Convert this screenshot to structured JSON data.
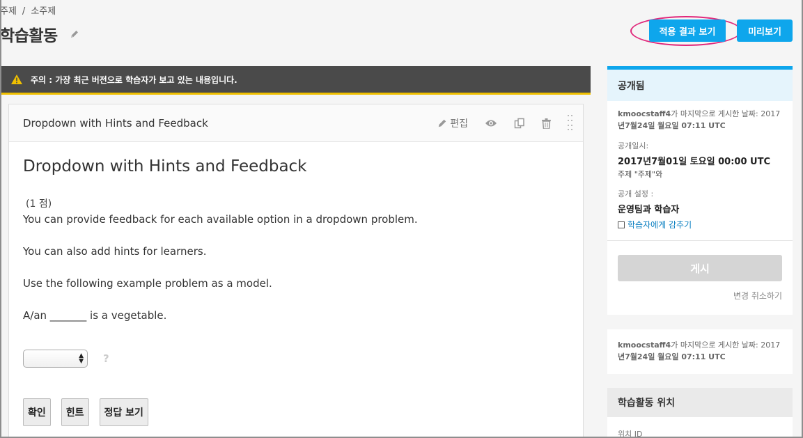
{
  "breadcrumb": {
    "items": [
      "주제",
      "소주제"
    ],
    "separator": "/"
  },
  "page": {
    "title": "학습활동"
  },
  "header": {
    "apply_button": "적용 결과 보기",
    "preview_button": "미리보기"
  },
  "warning": {
    "text": "주의 : 가장 최근 버전으로 학습자가 보고 있는 내용입니다."
  },
  "xblock": {
    "header_title": "Dropdown with Hints and Feedback",
    "edit_label": "편집",
    "problem_title": "Dropdown with Hints and Feedback",
    "points": "(1 점)",
    "paragraphs": [
      "You can provide feedback for each available option in a dropdown problem.",
      "You can also add hints for learners.",
      "Use the following example problem as a model.",
      "A/an _______ is a vegetable."
    ],
    "dropdown_value": "",
    "help_mark": "?",
    "buttons": {
      "check": "확인",
      "hint": "힌트",
      "show_answer": "정답 보기"
    }
  },
  "publish": {
    "status": "공개됨",
    "last_published_user": "kmoocstaff4",
    "last_published_text": "가 마지막으로 게시한 날짜: 2017",
    "last_published_date": "년7월24일 월요일 07:11 UTC",
    "release_label": "공개일시:",
    "release_value": "2017년7월01일 토요일 00:00 UTC",
    "release_sub": "주제 \"주제\"와",
    "visibility_label": "공개 설정 :",
    "visibility_value": "운영팀과 학습자",
    "hide_label": "학습자에게 감추기",
    "publish_button": "게시",
    "discard_link": "변경 취소하기"
  },
  "info": {
    "user": "kmoocstaff4",
    "text": "가 마지막으로 게시한 날짜: 2017",
    "date": "년7월24일 월요일 07:11 UTC"
  },
  "location": {
    "title": "학습활동 위치",
    "id_label": "위치 ID"
  },
  "colors": {
    "accent": "#0ea6ec",
    "warning_bar": "#4a4a4a",
    "warning_stripe": "#f0c000",
    "highlight": "#e0287b"
  }
}
